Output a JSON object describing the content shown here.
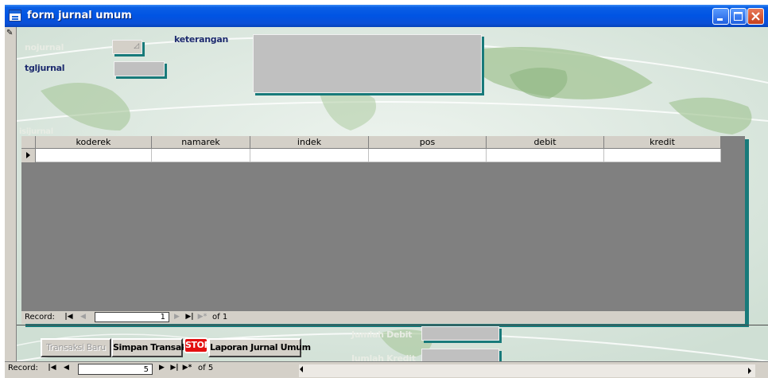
{
  "window": {
    "title": "form jurnal umum"
  },
  "form": {
    "nojurnal_label": "nojurnal",
    "tgljurnal_label": "tgljurnal",
    "keterangan_label": "keterangan",
    "isijurnal_label": "isijurnal",
    "jumlah_debit_label": "Jumlah Debit",
    "jumlah_kredit_label": "Jumlah Kredit"
  },
  "grid": {
    "columns": [
      "koderek",
      "namarek",
      "indek",
      "pos",
      "debit",
      "kredit"
    ]
  },
  "subform_nav": {
    "record_label": "Record:",
    "current": "1",
    "of_label": "of 1"
  },
  "main_nav": {
    "record_label": "Record:",
    "current": "5",
    "of_label": "of 5"
  },
  "buttons": {
    "transaksi_baru": "Transaksi Baru",
    "simpan_transaksi": "Simpan Transaksi",
    "stop": "STOP",
    "laporan": "Laporan Jurnal Umum"
  },
  "colors": {
    "titlebar": "#0054e3",
    "field_shadow": "#187a7a",
    "grid_bg": "#808080"
  }
}
